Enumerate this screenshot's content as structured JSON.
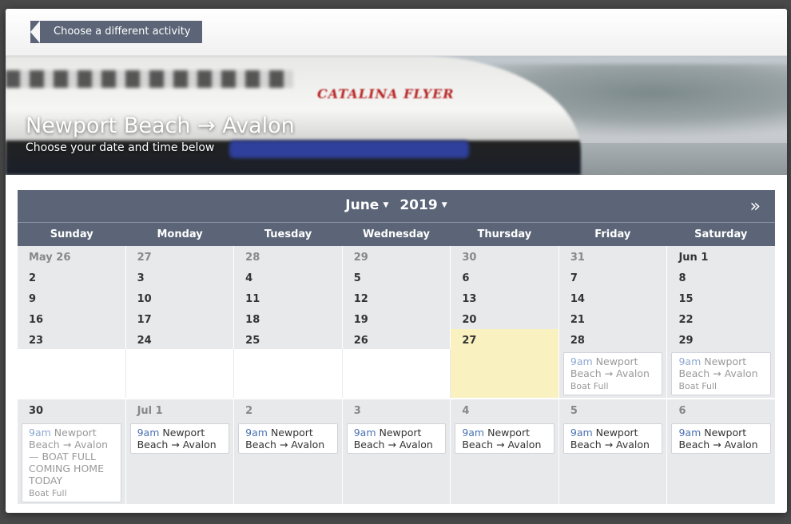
{
  "nav": {
    "back_label": "Choose a different activity"
  },
  "hero": {
    "title": "Newport Beach → Avalon",
    "subtitle": "Choose your date and time below",
    "ship_logo": "CATALINA FLYER"
  },
  "calendar": {
    "month": "June",
    "year": "2019",
    "next_label": "»",
    "weekdays": [
      "Sunday",
      "Monday",
      "Tuesday",
      "Wednesday",
      "Thursday",
      "Friday",
      "Saturday"
    ],
    "weeks": [
      [
        "May 26",
        "27",
        "28",
        "29",
        "30",
        "31",
        "Jun 1"
      ],
      [
        "2",
        "3",
        "4",
        "5",
        "6",
        "7",
        "8"
      ],
      [
        "9",
        "10",
        "11",
        "12",
        "13",
        "14",
        "15"
      ],
      [
        "16",
        "17",
        "18",
        "19",
        "20",
        "21",
        "22"
      ],
      [
        "23",
        "24",
        "25",
        "26",
        "27",
        "28",
        "29"
      ],
      [
        "30",
        "Jul 1",
        "2",
        "3",
        "4",
        "5",
        "6"
      ]
    ],
    "slot_time": "9am",
    "slot_route": "Newport Beach → Avalon",
    "slot_route_full_note": "Newport Beach → Avalon — BOAT FULL COMING HOME TODAY",
    "boat_full_label": "Boat Full",
    "today_color": "#faf1c0",
    "header_color": "#5b6577",
    "time_color": "#4a72b0"
  }
}
